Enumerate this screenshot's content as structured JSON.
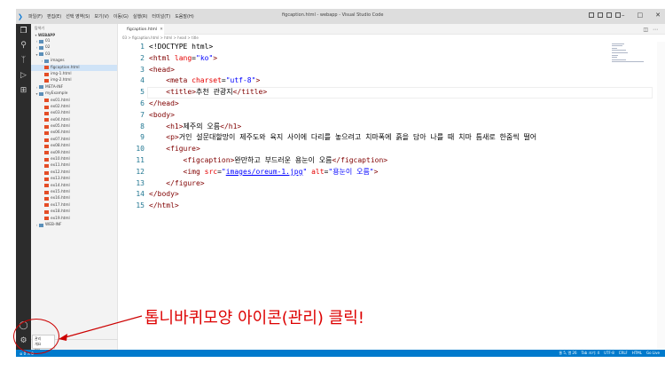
{
  "titlebar": {
    "menu": [
      "파일(F)",
      "편집(E)",
      "선택 영역(S)",
      "보기(V)",
      "이동(G)",
      "실행(R)",
      "터미널(T)",
      "도움말(H)"
    ],
    "title": "figcaption.html - webapp - Visual Studio Code"
  },
  "sidebar": {
    "header": "탐색기",
    "project": "WEBAPP",
    "tree": [
      {
        "label": "01",
        "type": "folder",
        "indent": 1,
        "expanded": false
      },
      {
        "label": "02",
        "type": "folder",
        "indent": 1,
        "expanded": false
      },
      {
        "label": "03",
        "type": "folder",
        "indent": 1,
        "expanded": true
      },
      {
        "label": "images",
        "type": "folder",
        "indent": 2,
        "expanded": false
      },
      {
        "label": "figcaption.html",
        "type": "html",
        "indent": 2,
        "selected": true
      },
      {
        "label": "img-1.html",
        "type": "html",
        "indent": 2
      },
      {
        "label": "img-2.html",
        "type": "html",
        "indent": 2
      },
      {
        "label": "META-INF",
        "type": "folder",
        "indent": 1,
        "expanded": false
      },
      {
        "label": "myExample",
        "type": "folder",
        "indent": 1,
        "expanded": true
      },
      {
        "label": "ex01.html",
        "type": "html",
        "indent": 2
      },
      {
        "label": "ex02.html",
        "type": "html",
        "indent": 2
      },
      {
        "label": "ex03.html",
        "type": "html",
        "indent": 2
      },
      {
        "label": "ex04.html",
        "type": "html",
        "indent": 2
      },
      {
        "label": "ex05.html",
        "type": "html",
        "indent": 2
      },
      {
        "label": "ex06.html",
        "type": "html",
        "indent": 2
      },
      {
        "label": "ex07.html",
        "type": "html",
        "indent": 2
      },
      {
        "label": "ex08.html",
        "type": "html",
        "indent": 2
      },
      {
        "label": "ex09.html",
        "type": "html",
        "indent": 2
      },
      {
        "label": "ex10.html",
        "type": "html",
        "indent": 2
      },
      {
        "label": "ex11.html",
        "type": "html",
        "indent": 2
      },
      {
        "label": "ex12.html",
        "type": "html",
        "indent": 2
      },
      {
        "label": "ex13.html",
        "type": "html",
        "indent": 2
      },
      {
        "label": "ex14.html",
        "type": "html",
        "indent": 2
      },
      {
        "label": "ex15.html",
        "type": "html",
        "indent": 2
      },
      {
        "label": "ex16.html",
        "type": "html",
        "indent": 2
      },
      {
        "label": "ex17.html",
        "type": "html",
        "indent": 2
      },
      {
        "label": "ex18.html",
        "type": "html",
        "indent": 2
      },
      {
        "label": "ex19.html",
        "type": "html",
        "indent": 2
      },
      {
        "label": "WEB-INF",
        "type": "folder",
        "indent": 1,
        "expanded": false
      }
    ],
    "bottom": [
      "관리",
      "개요"
    ]
  },
  "tab": {
    "label": "figcaption.html"
  },
  "breadcrumb": "03 > figcaption.html > html > head > title",
  "editor": {
    "line_numbers": [
      "1",
      "2",
      "3",
      "4",
      "5",
      "6",
      "7",
      "8",
      "9",
      "10",
      "11",
      "12",
      "13",
      "14",
      "15"
    ],
    "lines": [
      [
        {
          "c": "plain",
          "t": "<!DOCTYPE html>"
        }
      ],
      [
        {
          "c": "tag",
          "t": "<html "
        },
        {
          "c": "attr",
          "t": "lang"
        },
        {
          "c": "plain",
          "t": "="
        },
        {
          "c": "val",
          "t": "\"ko\""
        },
        {
          "c": "tag",
          "t": ">"
        }
      ],
      [
        {
          "c": "tag",
          "t": "<head>"
        }
      ],
      [
        {
          "c": "plain",
          "t": "    "
        },
        {
          "c": "tag",
          "t": "<meta "
        },
        {
          "c": "attr",
          "t": "charset"
        },
        {
          "c": "plain",
          "t": "="
        },
        {
          "c": "val",
          "t": "\"utf-8\""
        },
        {
          "c": "tag",
          "t": ">"
        }
      ],
      [
        {
          "c": "plain",
          "t": "    "
        },
        {
          "c": "tag",
          "t": "<title>"
        },
        {
          "c": "plain",
          "t": "추천 관광지"
        },
        {
          "c": "tag",
          "t": "</title>"
        }
      ],
      [
        {
          "c": "tag",
          "t": "</head>"
        }
      ],
      [
        {
          "c": "tag",
          "t": "<body>"
        }
      ],
      [
        {
          "c": "plain",
          "t": "    "
        },
        {
          "c": "tag",
          "t": "<h1>"
        },
        {
          "c": "plain",
          "t": "제주의 오름"
        },
        {
          "c": "tag",
          "t": "</h1>"
        }
      ],
      [
        {
          "c": "plain",
          "t": "    "
        },
        {
          "c": "tag",
          "t": "<p>"
        },
        {
          "c": "plain",
          "t": "거인 설문대할망이 제주도와 육지 사이에 다리를 놓으려고 치마폭에 흙을 담아 나를 때 치마 틈새로 한줌씩 떨어"
        }
      ],
      [
        {
          "c": "plain",
          "t": "    "
        },
        {
          "c": "tag",
          "t": "<figure>"
        }
      ],
      [
        {
          "c": "plain",
          "t": "        "
        },
        {
          "c": "tag",
          "t": "<figcaption>"
        },
        {
          "c": "plain",
          "t": "완만하고 부드러운 용눈이 오름"
        },
        {
          "c": "tag",
          "t": "</figcaption>"
        }
      ],
      [
        {
          "c": "plain",
          "t": "        "
        },
        {
          "c": "tag",
          "t": "<img "
        },
        {
          "c": "attr",
          "t": "src"
        },
        {
          "c": "plain",
          "t": "="
        },
        {
          "c": "val",
          "t": "\""
        },
        {
          "c": "link",
          "t": "images/oreum-1.jpg"
        },
        {
          "c": "val",
          "t": "\""
        },
        {
          "c": "plain",
          "t": " "
        },
        {
          "c": "attr",
          "t": "alt"
        },
        {
          "c": "plain",
          "t": "="
        },
        {
          "c": "val",
          "t": "\"용눈이 오름\""
        },
        {
          "c": "tag",
          "t": ">"
        }
      ],
      [
        {
          "c": "plain",
          "t": "    "
        },
        {
          "c": "tag",
          "t": "</figure>"
        }
      ],
      [
        {
          "c": "tag",
          "t": "</body>"
        }
      ],
      [
        {
          "c": "tag",
          "t": "</html>"
        }
      ]
    ]
  },
  "statusbar": {
    "right": [
      "줄 5, 열 26",
      "Tab 크기: 4",
      "UTF-8",
      "CRLF",
      "HTML",
      "Go Live"
    ]
  },
  "annotation": {
    "text": "톱니바퀴모양 아이콘(관리) 클릭!",
    "color": "#dd0000"
  },
  "colors": {
    "accent": "#007acc",
    "activity": "#2c2c2c"
  }
}
